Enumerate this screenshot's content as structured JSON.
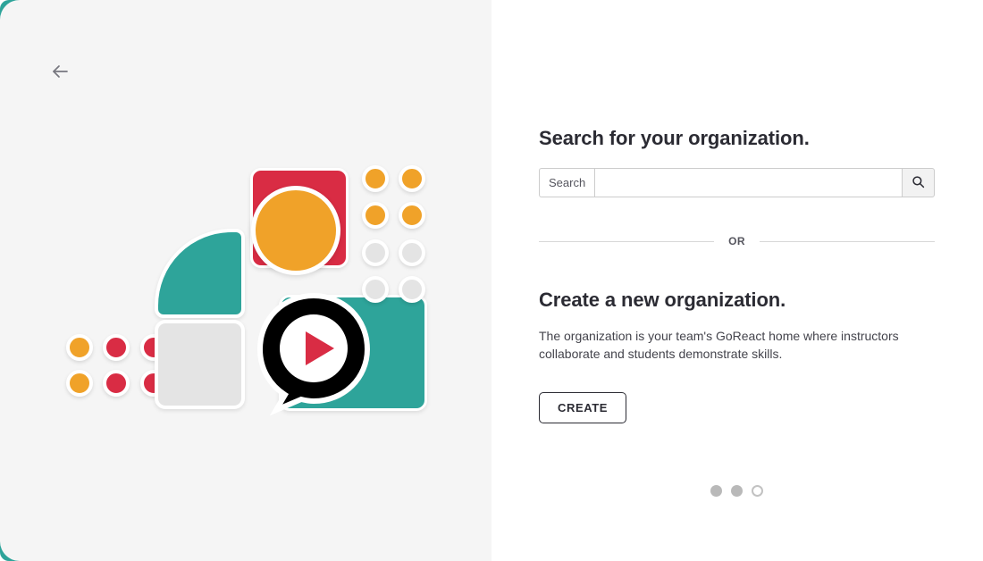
{
  "window": {
    "background_color": "#ffffff",
    "left_panel_color": "#f5f5f5",
    "accent_teal": "#2ea49a",
    "accent_orange": "#f0a229",
    "accent_red": "#d92c44",
    "accent_gray": "#e4e4e4"
  },
  "left_panel": {
    "back_button": {
      "name": "back-button",
      "icon": "arrow-left-icon"
    },
    "illustration": {
      "name": "organization-illustration",
      "shapes": [
        {
          "id": "red-rounded-square",
          "color": "#d92c44"
        },
        {
          "id": "teal-quarter-round",
          "color": "#2ea49a"
        },
        {
          "id": "gray-rounded-square",
          "color": "#e4e4e4"
        },
        {
          "id": "teal-rounded-square",
          "color": "#2ea49a"
        },
        {
          "id": "orange-circle",
          "color": "#f0a229"
        },
        {
          "id": "black-speech-bubble",
          "color": "#000000"
        },
        {
          "id": "play-triangle",
          "color": "#d92c44"
        }
      ],
      "dot_grid_right": {
        "columns": 2,
        "rows": 4,
        "row_colors": [
          "#f0a229",
          "#f0a229",
          "#e4e4e4",
          "#e4e4e4"
        ]
      },
      "dot_grid_left": {
        "columns": 3,
        "rows": 2,
        "column_colors": [
          "#f0a229",
          "#d92c44",
          "#d92c44"
        ]
      }
    }
  },
  "right_panel": {
    "search_section": {
      "heading": "Search for your organization.",
      "input_addon_label": "Search",
      "input_value": "",
      "input_placeholder": "",
      "search_icon": "magnifier-icon"
    },
    "divider": {
      "label": "OR"
    },
    "create_section": {
      "heading": "Create a new organization.",
      "description": "The organization is your team's GoReact home where instructors collaborate and students demonstrate skills.",
      "button_label": "CREATE"
    },
    "pagination": {
      "total": 3,
      "current": 2,
      "dots": [
        "filled",
        "filled",
        "hollow"
      ]
    }
  }
}
